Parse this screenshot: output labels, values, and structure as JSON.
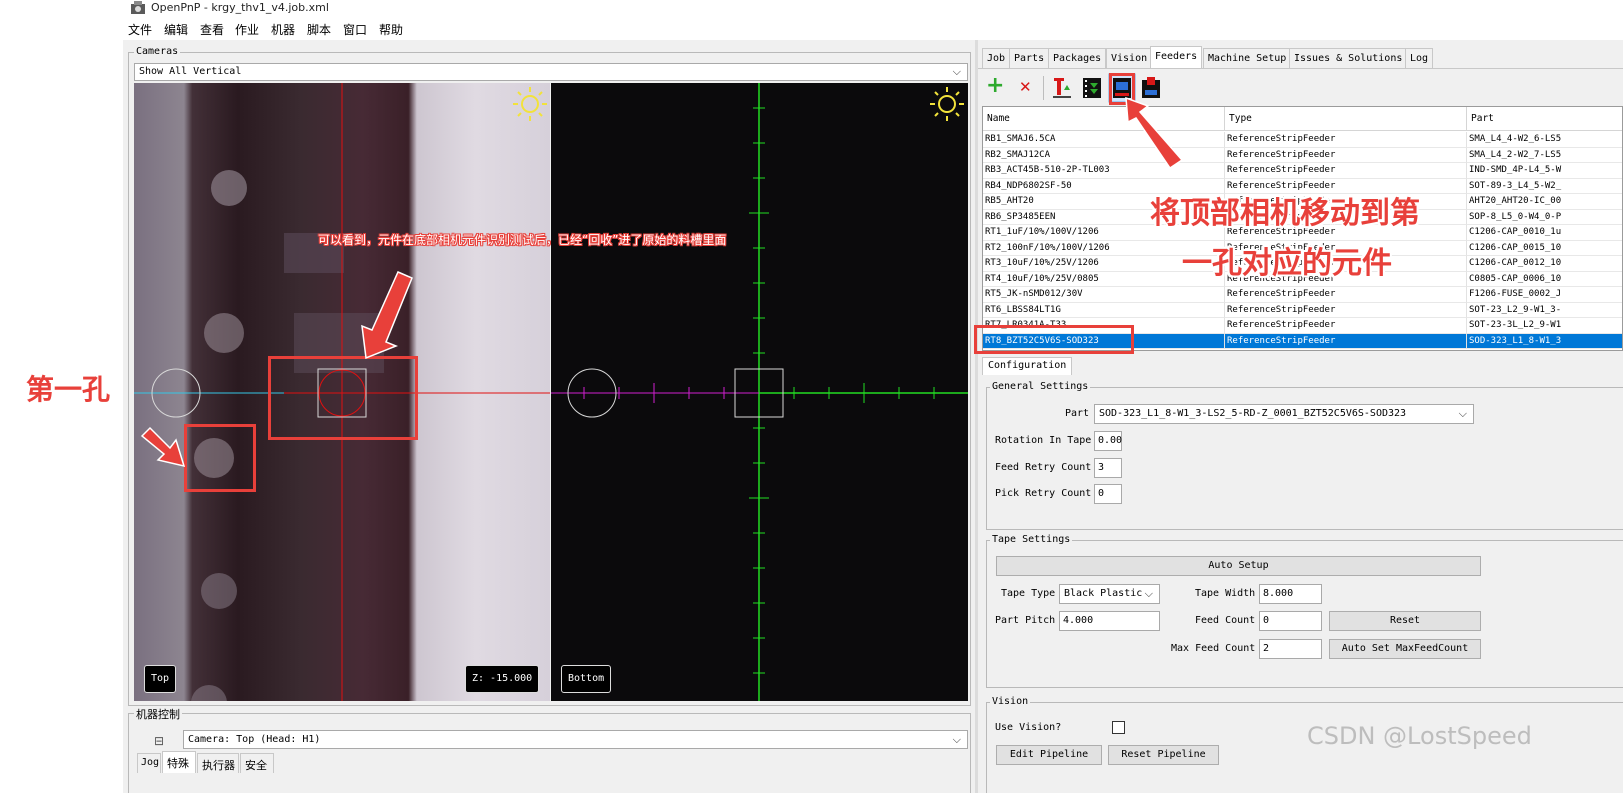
{
  "window": {
    "title": "OpenPnP - krgy_thv1_v4.job.xml"
  },
  "menu": [
    "文件",
    "编辑",
    "查看",
    "作业",
    "机器",
    "脚本",
    "窗口",
    "帮助"
  ],
  "cameras": {
    "group_title": "Cameras",
    "layout_select": "Show All Vertical",
    "top_badge": "Top",
    "z_badge": "Z: -15.000",
    "bottom_badge": "Bottom"
  },
  "machine_control": {
    "group_title": "机器控制",
    "collapse_symbol": "⊟",
    "camera_select": "Camera: Top (Head: H1)",
    "tabs": [
      "Jog",
      "特殊",
      "执行器",
      "安全"
    ]
  },
  "tabs": [
    "Job",
    "Parts",
    "Packages",
    "Vision",
    "Feeders",
    "Machine Setup",
    "Issues & Solutions",
    "Log"
  ],
  "active_tab": "Feeders",
  "toolbar": {
    "icons": [
      "plus-icon",
      "delete-x-icon",
      "pick-feeder-icon",
      "feed-icon",
      "move-camera-to-feeder-icon",
      "move-tool-to-feeder-icon"
    ],
    "plus_glyph": "+",
    "delete_glyph": "✕"
  },
  "feeder_table": {
    "columns": [
      "Name",
      "Type",
      "Part"
    ],
    "rows": [
      [
        "RB1_SMAJ6.5CA",
        "ReferenceStripFeeder",
        "SMA_L4_4-W2_6-LS5"
      ],
      [
        "RB2_SMAJ12CA",
        "ReferenceStripFeeder",
        "SMA_L4_2-W2_7-LS5"
      ],
      [
        "RB3_ACT45B-510-2P-TL003",
        "ReferenceStripFeeder",
        "IND-SMD_4P-L4_5-W"
      ],
      [
        "RB4_NDP6802SF-50",
        "ReferenceStripFeeder",
        "SOT-89-3_L4_5-W2_"
      ],
      [
        "RB5_AHT20",
        "ReferenceStripFeeder",
        "AHT20_AHT20-IC_00"
      ],
      [
        "RB6_SP3485EEN",
        "ReferenceStripFeeder",
        "SOP-8_L5_0-W4_0-P"
      ],
      [
        "RT1_1uF/10%/100V/1206",
        "ReferenceStripFeeder",
        "C1206-CAP_0010_1u"
      ],
      [
        "RT2_100nF/10%/100V/1206",
        "ReferenceStripFeeder",
        "C1206-CAP_0015_10"
      ],
      [
        "RT3_10uF/10%/25V/1206",
        "ReferenceStripFeeder",
        "C1206-CAP_0012_10"
      ],
      [
        "RT4_10uF/10%/25V/0805",
        "ReferenceStripFeeder",
        "C0805-CAP_0006_10"
      ],
      [
        "RT5_JK-nSMD012/30V",
        "ReferenceStripFeeder",
        "F1206-FUSE_0002_J"
      ],
      [
        "RT6_LBSS84LT1G",
        "ReferenceStripFeeder",
        "SOT-23_L2_9-W1_3-"
      ],
      [
        "RT7_LR0341A-T33",
        "ReferenceStripFeeder",
        "SOT-23-3L_L2_9-W1"
      ],
      [
        "RT8_BZT52C5V6S-SOD323",
        "ReferenceStripFeeder",
        "SOD-323_L1_8-W1_3"
      ]
    ],
    "selected_index": 13
  },
  "config": {
    "tab_label": "Configuration",
    "general": {
      "title": "General Settings",
      "part_label": "Part",
      "part_value": "SOD-323_L1_8-W1_3-LS2_5-RD-Z_0001_BZT52C5V6S-SOD323",
      "rotation_label": "Rotation In Tape",
      "rotation_value": "0.00",
      "feed_retry_label": "Feed Retry Count",
      "feed_retry_value": "3",
      "pick_retry_label": "Pick Retry Count",
      "pick_retry_value": "0"
    },
    "tape": {
      "title": "Tape Settings",
      "auto_setup": "Auto Setup",
      "tape_type_label": "Tape Type",
      "tape_type_value": "Black Plastic",
      "tape_width_label": "Tape Width",
      "tape_width_value": "8.000",
      "part_pitch_label": "Part Pitch",
      "part_pitch_value": "4.000",
      "feed_count_label": "Feed Count",
      "feed_count_value": "0",
      "reset": "Reset",
      "max_feed_label": "Max Feed Count",
      "max_feed_value": "2",
      "auto_set_max": "Auto Set MaxFeedCount"
    },
    "vision": {
      "title": "Vision",
      "use_vision_label": "Use Vision?",
      "edit_pipeline": "Edit Pipeline",
      "reset_pipeline": "Reset Pipeline"
    }
  },
  "annotations": {
    "first_hole": "第一孔",
    "recycled_note": "可以看到，元件在底部相机元件识别测试后，已经“回收”进了原始的料槽里面",
    "move_line1": "将顶部相机移动到第",
    "move_line2": "一孔对应的元件",
    "accent_color": "#e8403a"
  },
  "watermark": "CSDN @LostSpeed"
}
